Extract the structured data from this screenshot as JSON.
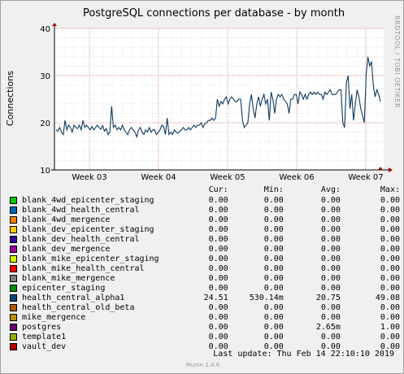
{
  "chart_data": {
    "type": "line",
    "title": "PostgreSQL connections per database - by month",
    "ylabel": "Connections",
    "ylim": [
      10,
      40
    ],
    "yticks": [
      "10",
      "20",
      "30",
      "40"
    ],
    "xticks": [
      "Week 03",
      "Week 04",
      "Week 05",
      "Week 06",
      "Week 07"
    ],
    "grid": true,
    "side_text": "RRDTOOL / TOBI OETIKER",
    "series": [
      {
        "name": "health_central_alpha1",
        "color": "#0f3a5f",
        "values": [
          18.5,
          18.2,
          19.0,
          18.0,
          17.5,
          20.5,
          18.5,
          19.5,
          19.0,
          18.0,
          19.5,
          19.0,
          18.8,
          19.5,
          18.5,
          20.5,
          19.0,
          19.5,
          19.0,
          18.5,
          19.2,
          18.5,
          19.0,
          19.5,
          19.0,
          18.6,
          19.4,
          18.2,
          18.8,
          17.5,
          18.0,
          23.5,
          19.0,
          19.5,
          18.5,
          19.0,
          18.5,
          19.5,
          18.5,
          18.0,
          17.5,
          18.5,
          19.0,
          18.5,
          18.0,
          17.0,
          18.5,
          19.0,
          18.0,
          17.5,
          18.5,
          18.0,
          19.0,
          18.0,
          18.5,
          18.5,
          17.5,
          18.0,
          18.5,
          19.5,
          19.2,
          17.5,
          21.0,
          17.5,
          18.0,
          17.5,
          18.5,
          18.0,
          17.8,
          18.2,
          18.5,
          19.0,
          18.5,
          18.5,
          19.0,
          18.5,
          19.0,
          19.5,
          19.0,
          19.5,
          19.5,
          20.0,
          19.0,
          19.8,
          20.0,
          20.5,
          20.5,
          21.0,
          20.5,
          21.0,
          25.0,
          23.5,
          24.5,
          24.0,
          25.0,
          25.5,
          24.0,
          25.0,
          25.5,
          25.0,
          24.5,
          24.5,
          25.0,
          25.0,
          20.5,
          19.0,
          19.5,
          20.0,
          24.0,
          26.0,
          23.0,
          21.0,
          24.0,
          25.5,
          23.5,
          25.0,
          26.0,
          24.0,
          25.0,
          20.5,
          26.5,
          25.0,
          22.0,
          25.0,
          26.0,
          25.5,
          26.0,
          25.0,
          24.5,
          24.0,
          22.0,
          25.0,
          25.0,
          26.0,
          26.0,
          24.0,
          26.5,
          26.0,
          25.0,
          26.0,
          25.0,
          26.0,
          26.5,
          26.0,
          26.5,
          26.0,
          26.5,
          26.0,
          26.0,
          25.0,
          26.5,
          26.0,
          26.5,
          27.0,
          26.0,
          26.0,
          26.0,
          26.5,
          27.0,
          27.0,
          20.0,
          19.0,
          28.5,
          30.0,
          23.0,
          26.0,
          20.5,
          24.0,
          27.0,
          25.5,
          23.0,
          21.5,
          20.0,
          30.0,
          34.0,
          32.0,
          33.0,
          28.0,
          25.5,
          27.0,
          26.0,
          24.5
        ]
      }
    ]
  },
  "legend": {
    "headers": {
      "cur": "Cur:",
      "min": "Min:",
      "avg": "Avg:",
      "max": "Max:"
    },
    "rows": [
      {
        "name": "blank_4wd_epicenter_staging",
        "color": "#00cc00",
        "cur": "0.00",
        "min": "0.00",
        "avg": "0.00",
        "max": "0.00"
      },
      {
        "name": "blank_4wd_health_central",
        "color": "#0066b3",
        "cur": "0.00",
        "min": "0.00",
        "avg": "0.00",
        "max": "0.00"
      },
      {
        "name": "blank_4wd_mergence",
        "color": "#ff8000",
        "cur": "0.00",
        "min": "0.00",
        "avg": "0.00",
        "max": "0.00"
      },
      {
        "name": "blank_dev_epicenter_staging",
        "color": "#ffcc00",
        "cur": "0.00",
        "min": "0.00",
        "avg": "0.00",
        "max": "0.00"
      },
      {
        "name": "blank_dev_health_central",
        "color": "#330099",
        "cur": "0.00",
        "min": "0.00",
        "avg": "0.00",
        "max": "0.00"
      },
      {
        "name": "blank_dev_mergence",
        "color": "#990099",
        "cur": "0.00",
        "min": "0.00",
        "avg": "0.00",
        "max": "0.00"
      },
      {
        "name": "blank_mike_epicenter_staging",
        "color": "#ccff00",
        "cur": "0.00",
        "min": "0.00",
        "avg": "0.00",
        "max": "0.00"
      },
      {
        "name": "blank_mike_health_central",
        "color": "#ff0000",
        "cur": "0.00",
        "min": "0.00",
        "avg": "0.00",
        "max": "0.00"
      },
      {
        "name": "blank_mike_mergence",
        "color": "#808080",
        "cur": "0.00",
        "min": "0.00",
        "avg": "0.00",
        "max": "0.00"
      },
      {
        "name": "epicenter_staging",
        "color": "#008f00",
        "cur": "0.00",
        "min": "0.00",
        "avg": "0.00",
        "max": "0.00"
      },
      {
        "name": "health_central_alpha1",
        "color": "#00487d",
        "cur": "24.51",
        "min": "530.14m",
        "avg": "20.75",
        "max": "49.08"
      },
      {
        "name": "health_central_old_beta",
        "color": "#b35a00",
        "cur": "0.00",
        "min": "0.00",
        "avg": "0.00",
        "max": "0.00"
      },
      {
        "name": "mike_mergence",
        "color": "#b38f00",
        "cur": "0.00",
        "min": "0.00",
        "avg": "0.00",
        "max": "0.00"
      },
      {
        "name": "postgres",
        "color": "#6b006b",
        "cur": "0.00",
        "min": "0.00",
        "avg": "2.65m",
        "max": "1.00"
      },
      {
        "name": "template1",
        "color": "#8fb300",
        "cur": "0.00",
        "min": "0.00",
        "avg": "0.00",
        "max": "0.00"
      },
      {
        "name": "vault_dev",
        "color": "#b30000",
        "cur": "0.00",
        "min": "0.00",
        "avg": "0.00",
        "max": "0.00"
      }
    ]
  },
  "footer": {
    "last_update": "Last update:  Thu Feb 14 22:10:10 2019",
    "version": "Munin 1.4.6"
  }
}
